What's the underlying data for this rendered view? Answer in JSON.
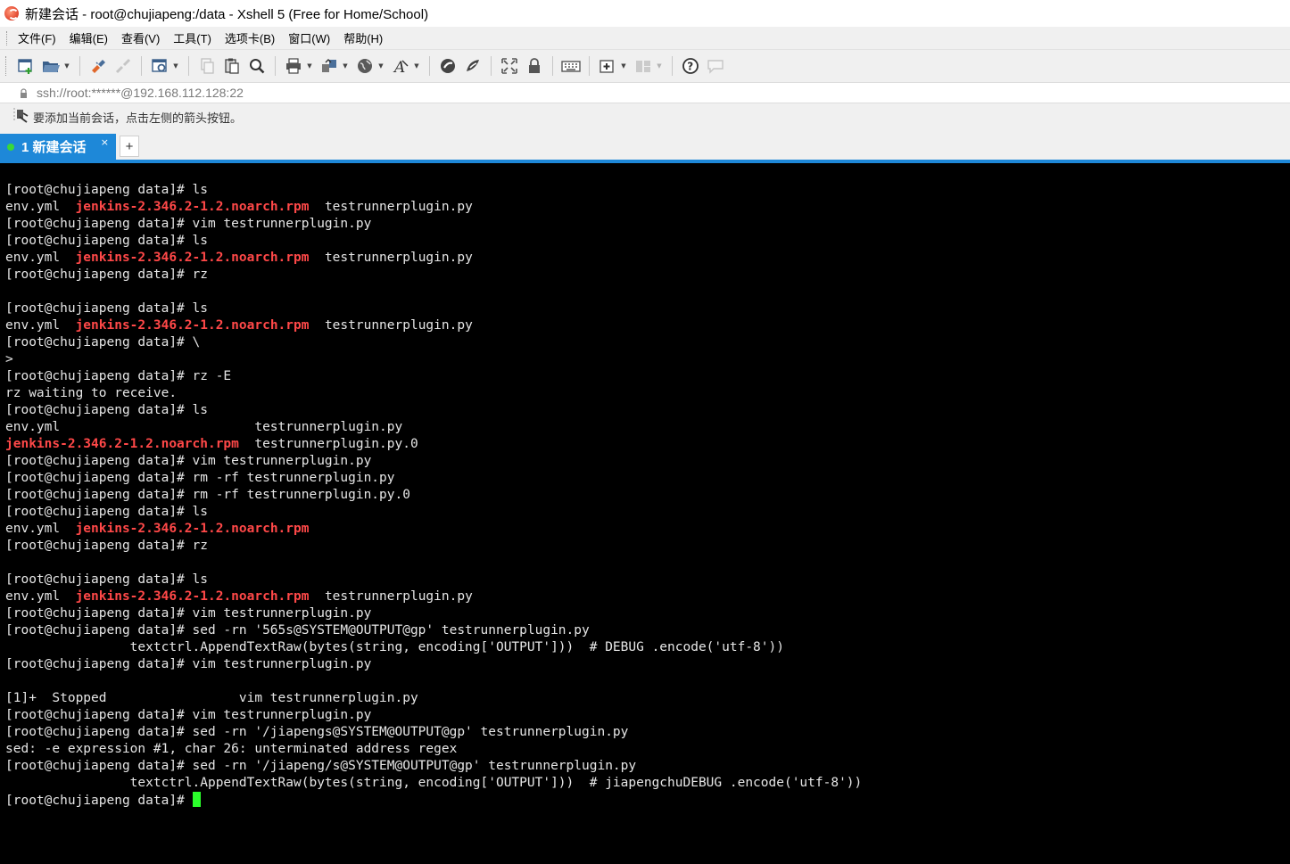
{
  "window": {
    "title": "新建会话 - root@chujiapeng:/data - Xshell 5 (Free for Home/School)"
  },
  "menu": [
    {
      "label": "文件(F)"
    },
    {
      "label": "编辑(E)"
    },
    {
      "label": "查看(V)"
    },
    {
      "label": "工具(T)"
    },
    {
      "label": "选项卡(B)"
    },
    {
      "label": "窗口(W)"
    },
    {
      "label": "帮助(H)"
    }
  ],
  "toolbar": {
    "icons": [
      "new-session-icon",
      "open-folder-icon",
      "reconnect-icon",
      "disconnect-icon",
      "properties-icon",
      "copy-icon",
      "paste-icon",
      "find-icon",
      "print-icon",
      "transfer-icon",
      "globe-icon",
      "font-icon",
      "xftp-icon",
      "xmanager-icon",
      "fullscreen-icon",
      "lock-icon",
      "keyboard-icon",
      "add-tab-icon",
      "layout-icon",
      "help-icon",
      "chat-icon"
    ]
  },
  "address": {
    "text": "ssh://root:******@192.168.112.128:22"
  },
  "hint": {
    "text": "要添加当前会话，点击左侧的箭头按钮。"
  },
  "tabs": [
    {
      "label": "1 新建会话",
      "close": "×",
      "status_color": "#39d839"
    }
  ],
  "tab_add_label": "+",
  "colors": {
    "accent": "#1e88d8",
    "terminal_bg": "#000000",
    "terminal_fg": "#e6e6e6",
    "rpm_highlight": "#ff4848",
    "cursor": "#2bff2b"
  },
  "terminal": {
    "lines": [
      [
        {
          "t": "[root@chujiapeng data]# ls"
        }
      ],
      [
        {
          "t": "env.yml  "
        },
        {
          "t": "jenkins-2.346.2-1.2.noarch.rpm",
          "c": "red"
        },
        {
          "t": "  testrunnerplugin.py"
        }
      ],
      [
        {
          "t": "[root@chujiapeng data]# vim testrunnerplugin.py"
        }
      ],
      [
        {
          "t": "[root@chujiapeng data]# ls"
        }
      ],
      [
        {
          "t": "env.yml  "
        },
        {
          "t": "jenkins-2.346.2-1.2.noarch.rpm",
          "c": "red"
        },
        {
          "t": "  testrunnerplugin.py"
        }
      ],
      [
        {
          "t": "[root@chujiapeng data]# rz"
        }
      ],
      [
        {
          "t": ""
        }
      ],
      [
        {
          "t": "[root@chujiapeng data]# ls"
        }
      ],
      [
        {
          "t": "env.yml  "
        },
        {
          "t": "jenkins-2.346.2-1.2.noarch.rpm",
          "c": "red"
        },
        {
          "t": "  testrunnerplugin.py"
        }
      ],
      [
        {
          "t": "[root@chujiapeng data]# \\"
        }
      ],
      [
        {
          "t": ">"
        }
      ],
      [
        {
          "t": "[root@chujiapeng data]# rz -E"
        }
      ],
      [
        {
          "t": "rz waiting to receive."
        }
      ],
      [
        {
          "t": "[root@chujiapeng data]# ls"
        }
      ],
      [
        {
          "t": "env.yml                         testrunnerplugin.py"
        }
      ],
      [
        {
          "t": "jenkins-2.346.2-1.2.noarch.rpm",
          "c": "red"
        },
        {
          "t": "  testrunnerplugin.py.0"
        }
      ],
      [
        {
          "t": "[root@chujiapeng data]# vim testrunnerplugin.py"
        }
      ],
      [
        {
          "t": "[root@chujiapeng data]# rm -rf testrunnerplugin.py"
        }
      ],
      [
        {
          "t": "[root@chujiapeng data]# rm -rf testrunnerplugin.py.0"
        }
      ],
      [
        {
          "t": "[root@chujiapeng data]# ls"
        }
      ],
      [
        {
          "t": "env.yml  "
        },
        {
          "t": "jenkins-2.346.2-1.2.noarch.rpm",
          "c": "red"
        }
      ],
      [
        {
          "t": "[root@chujiapeng data]# rz"
        }
      ],
      [
        {
          "t": ""
        }
      ],
      [
        {
          "t": "[root@chujiapeng data]# ls"
        }
      ],
      [
        {
          "t": "env.yml  "
        },
        {
          "t": "jenkins-2.346.2-1.2.noarch.rpm",
          "c": "red"
        },
        {
          "t": "  testrunnerplugin.py"
        }
      ],
      [
        {
          "t": "[root@chujiapeng data]# vim testrunnerplugin.py"
        }
      ],
      [
        {
          "t": "[root@chujiapeng data]# sed -rn '565s@SYSTEM@OUTPUT@gp' testrunnerplugin.py"
        }
      ],
      [
        {
          "t": "                textctrl.AppendTextRaw(bytes(string, encoding['OUTPUT']))  # DEBUG .encode('utf-8'))"
        }
      ],
      [
        {
          "t": "[root@chujiapeng data]# vim testrunnerplugin.py"
        }
      ],
      [
        {
          "t": ""
        }
      ],
      [
        {
          "t": "[1]+  Stopped                 vim testrunnerplugin.py"
        }
      ],
      [
        {
          "t": "[root@chujiapeng data]# vim testrunnerplugin.py"
        }
      ],
      [
        {
          "t": "[root@chujiapeng data]# sed -rn '/jiapengs@SYSTEM@OUTPUT@gp' testrunnerplugin.py"
        }
      ],
      [
        {
          "t": "sed: -e expression #1, char 26: unterminated address regex"
        }
      ],
      [
        {
          "t": "[root@chujiapeng data]# sed -rn '/jiapeng/s@SYSTEM@OUTPUT@gp' testrunnerplugin.py"
        }
      ],
      [
        {
          "t": "                textctrl.AppendTextRaw(bytes(string, encoding['OUTPUT']))  # jiapengchuDEBUG .encode('utf-8'))"
        }
      ],
      [
        {
          "t": "[root@chujiapeng data]# "
        },
        {
          "cursor": true
        }
      ]
    ]
  }
}
